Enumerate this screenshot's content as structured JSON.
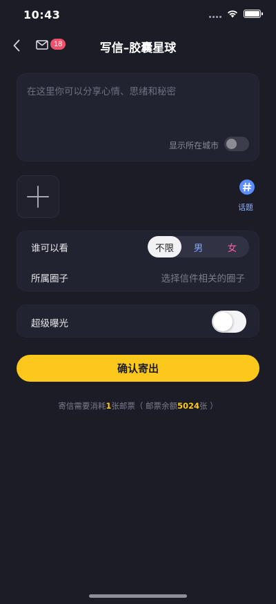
{
  "status_bar": {
    "time": "10:43"
  },
  "nav": {
    "title": "写信–胶囊星球",
    "mail_badge": "18"
  },
  "compose": {
    "placeholder": "在这里你可以分享心情、思绪和秘密",
    "show_city_label": "显示所在城市",
    "show_city_enabled": false
  },
  "topic": {
    "label": "话题"
  },
  "visibility": {
    "label": "谁可以看",
    "options": [
      "不限",
      "男",
      "女"
    ],
    "selected": "不限"
  },
  "circle": {
    "label": "所属圈子",
    "placeholder": "选择信件相关的圈子"
  },
  "super_exposure": {
    "label": "超级曝光",
    "enabled": false
  },
  "confirm_button": {
    "label": "确认寄出"
  },
  "cost_note": {
    "prefix": "寄信需要消耗",
    "cost": "1",
    "mid": "张邮票（ 邮票余额",
    "balance": "5024",
    "suffix": "张 ）"
  },
  "colors": {
    "background": "#1b1c26",
    "accent_yellow": "#fbc81b",
    "badge_red": "#f0516a",
    "male_blue": "#7ea6ff",
    "female_pink": "#ff5aa8",
    "topic_blue": "#8eb0ff"
  },
  "icons": {
    "back": "chevron-left-icon",
    "mail": "mail-icon",
    "add": "plus-icon",
    "topic": "hashtag-icon",
    "wifi": "wifi-icon",
    "signal": "signal-icon",
    "battery": "battery-icon"
  }
}
